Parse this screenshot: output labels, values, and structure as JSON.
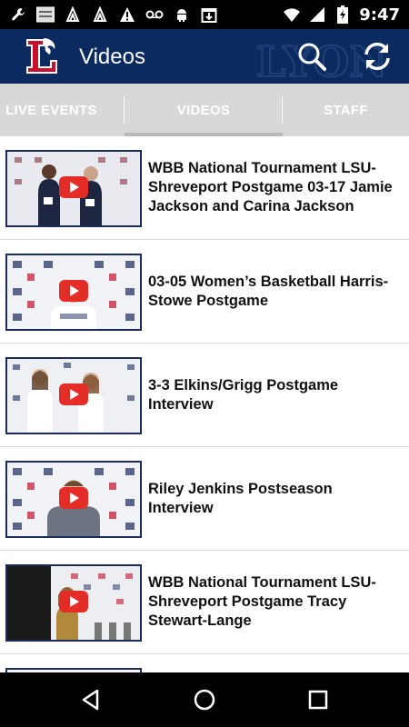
{
  "status_bar": {
    "time": "9:47",
    "left_icons": [
      "wrench-icon",
      "notification-thumbnail-icon",
      "up-arrows-icon",
      "up-arrows-icon",
      "alert-icon",
      "voicemail-icon",
      "android-icon",
      "calendar-download-icon"
    ],
    "right_icons": [
      "wifi-icon",
      "signal-icon",
      "battery-charging-icon"
    ]
  },
  "app_bar": {
    "title": "Videos",
    "color": "#0b2a60",
    "logo_letter": "L",
    "watermark_text": "LYON",
    "actions": [
      "search-icon",
      "refresh-icon"
    ]
  },
  "tabs": [
    {
      "label": "LIVE EVENTS"
    },
    {
      "label": "VIDEOS",
      "selected": true
    },
    {
      "label": "STAFF"
    }
  ],
  "videos": [
    {
      "title": "WBB National Tournament LSU-Shreveport Postgame 03-17 Jamie Jackson and Carina Jackson"
    },
    {
      "title": "03-05 Women’s Basketball Harris-Stowe Postgame"
    },
    {
      "title": "3-3 Elkins/Grigg Postgame Interview"
    },
    {
      "title": "Riley Jenkins Postseason Interview"
    },
    {
      "title": "WBB National Tournament LSU-Shreveport Postgame Tracy Stewart-Lange"
    },
    {
      "title": ""
    }
  ],
  "nav_bar": {
    "buttons": [
      "back-icon",
      "home-icon",
      "recents-icon"
    ]
  }
}
